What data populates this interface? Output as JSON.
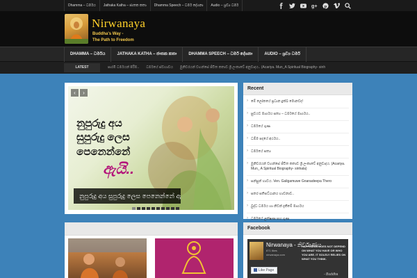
{
  "top_menu": [
    "Dhamma – ධර්මය",
    "Jathaka Katha – ජාතක කතා",
    "Dhamma Speech – ධර්ම දේශනා",
    "Audio – ශ්‍රව්‍ය ධර්ම"
  ],
  "social_icons": [
    "facebook-icon",
    "twitter-icon",
    "youtube-icon",
    "googleplus-icon",
    "pinterest-icon",
    "vimeo-icon",
    "search-icon"
  ],
  "site": {
    "title": "Nirwanaya",
    "tagline_1": "Buddha's Way -",
    "tagline_2": "The Path to Freedom"
  },
  "main_nav": [
    "DHAMMA – ධර්මය",
    "JATHAKA KATHA – ජාතක කතා",
    "DHAMMA SPEECH – ධර්ම දේශනා",
    "AUDIO – ශ්‍රව්‍ය ධර්ම"
  ],
  "ticker": {
    "label": "LATEST",
    "items": [
      "පාරමී ධර්මයන් පිරීම..",
      "ධර්මයේ ස්වභාවය",
      "මුනිවරයන් වහන්සේ ජීවිත කතාව ශ්‍රී ලංකාවේ අනුවාදය.. (Acariya. Mun_A Spiritual Biography- sinh"
    ]
  },
  "slider": {
    "line1": "නුපුරුදු අය",
    "line2": "සුපුරුදු ලෙස",
    "line3": "පෙනෙන්නේ",
    "line4": "ඇයි..",
    "caption": "නුපුරුදු අය සුපුරුදු ලෙස පෙනෙන්නේ ඇයි?",
    "prev": "‹",
    "next": "›",
    "dots": 10,
    "active_dot": 0
  },
  "recent": {
    "title": "Recent",
    "items": [
      "මේ ලෝකයේ ප්‍රධාන දුක්ඛ මොනවද!",
      "සුවයට මාර්ගය සත්‍ය – ධර්මයේ මාර්ගය..",
      "ධර්මයේ ගුණ",
      "ධම්ම පදයේ අර්ථය..",
      "ධර්මයේ සත්‍ය",
      "මුනිවරයන් වහන්සේ ජීවිත කතාව ශ්‍රී ලංකාවේ අනුවාදය. (Acariya. Mun_ A Spiritual Biography- sinhala)",
      "සන්සුන් භාවය. Ven. Galigamuwe Gnanadeepa Thero",
      "සතර සතිපට්ඨානය භාවනාව..",
      "බුද්ධ ධර්මය හා නිවන් දැකීමේ මාර්ගය",
      "ධර්මයේ ලක්ෂණ සහ ගුණ"
    ]
  },
  "facebook": {
    "title": "Facebook",
    "page_name": "Nirwanaya - නිර්වාණය",
    "likes": "871 likes",
    "domain": "nirwanaya.com",
    "quote": "HAPPINESS DOES NOT DEPEND ON WHAT YOU HAVE OR WHO YOU ARE. IT SOLELY RELIES ON WHAT YOU THINK.",
    "like_button": "Like Page",
    "signature": "- Buddha"
  }
}
